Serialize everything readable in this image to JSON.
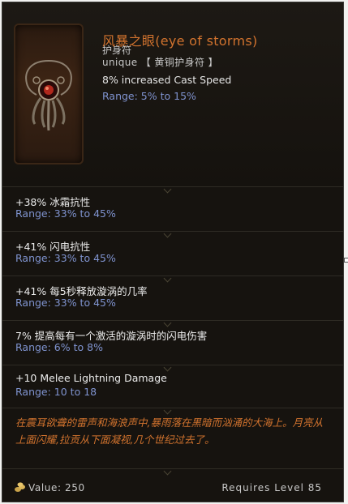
{
  "item": {
    "name": "风暴之眼(eye of storms)",
    "type": "护身符",
    "rarity": "unique 【 黄铜护身符 】",
    "implicit": {
      "stat": "8% increased Cast Speed",
      "range": "Range: 5% to 15%"
    },
    "mods": [
      {
        "stat": "+38% 冰霜抗性",
        "range": "Range: 33% to 45%"
      },
      {
        "stat": "+41% 闪电抗性",
        "range": "Range: 33% to 45%"
      },
      {
        "stat": "+41% 每5秒释放漩涡的几率",
        "range": "Range: 33% to 45%"
      },
      {
        "stat": "7% 提高每有一个激活的漩涡时的闪电伤害",
        "range": "Range: 6% to 8%"
      },
      {
        "stat": "+10 Melee Lightning Damage",
        "range": "Range: 10 to 18"
      }
    ],
    "lore": "在震耳欲聋的雷声和海浪声中,暴雨落在黑暗而汹涌的大海上。月亮从上面闪耀,拉贡从下面凝视,几个世纪过去了。",
    "value": "Value: 250",
    "requirement": "Requires Level 85"
  },
  "colors": {
    "unique": "#d2732e",
    "range": "#7f93cf",
    "stat": "#ececec"
  },
  "icons": [
    "amulet-icon",
    "coin-icon"
  ]
}
